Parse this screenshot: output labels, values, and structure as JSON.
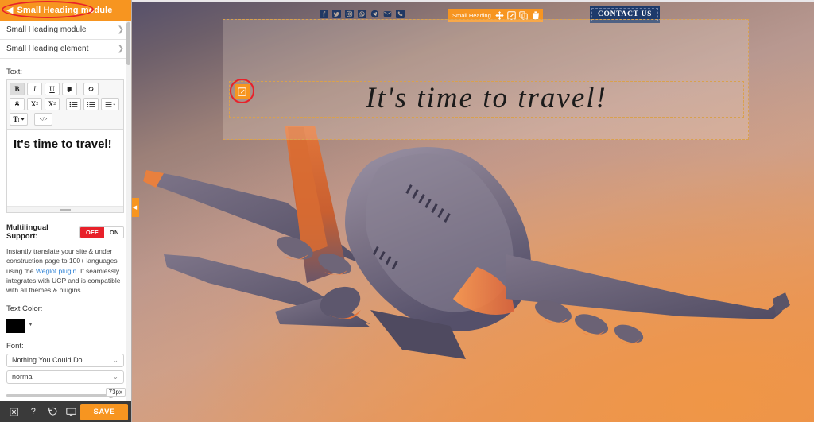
{
  "panel": {
    "header_title": "Small Heading module",
    "back_icon": "arrow-left-icon",
    "accordion": [
      {
        "label": "Small Heading module",
        "chevron": "chevron-right-icon"
      },
      {
        "label": "Small Heading element",
        "chevron": "chevron-down-icon"
      }
    ],
    "text_field_label": "Text:",
    "editor_toolbar": [
      {
        "name": "bold-icon",
        "glyph": "B",
        "active": true
      },
      {
        "name": "italic-icon",
        "glyph": "I",
        "active": false
      },
      {
        "name": "underline-icon",
        "glyph": "U",
        "active": false
      },
      {
        "name": "format-paint-icon",
        "glyph": "▐",
        "active": false
      },
      {
        "name": "link-icon",
        "glyph": "∞",
        "active": false
      },
      {
        "name": "strikethrough-icon",
        "glyph": "S",
        "active": false
      },
      {
        "name": "superscript-icon",
        "glyph": "X",
        "active": false
      },
      {
        "name": "subscript-icon",
        "glyph": "X",
        "active": false
      },
      {
        "name": "unordered-list-icon",
        "glyph": "≡",
        "active": false
      },
      {
        "name": "ordered-list-icon",
        "glyph": "≡",
        "active": false
      },
      {
        "name": "align-icon",
        "glyph": "≡",
        "active": false
      },
      {
        "name": "text-format-icon",
        "glyph": "T",
        "active": false
      },
      {
        "name": "code-view-icon",
        "glyph": "</>",
        "active": false
      }
    ],
    "editor_value": "It's time to travel!",
    "multilingual": {
      "label": "Multilingual Support:",
      "options": [
        "OFF",
        "ON"
      ],
      "selected": "OFF",
      "description_1": "Instantly translate your site & under construction page to 100+ languages using the ",
      "link_text": "Weglot plugin",
      "description_2": ". It seamlessly integrates with UCP and is compatible with all themes & plugins."
    },
    "text_color": {
      "label": "Text Color:",
      "value": "#000000"
    },
    "font": {
      "label": "Font:",
      "family": "Nothing You Could Do",
      "weight": "normal",
      "size": "73px"
    },
    "footer": {
      "icons": [
        {
          "name": "close-icon",
          "glyph": "☒"
        },
        {
          "name": "help-icon",
          "glyph": "?"
        },
        {
          "name": "history-undo-icon",
          "glyph": "↺"
        },
        {
          "name": "preview-monitor-icon",
          "glyph": "▭"
        }
      ],
      "save_label": "SAVE"
    }
  },
  "canvas": {
    "social_icons": [
      "facebook-icon",
      "twitter-icon",
      "instagram-icon",
      "whatsapp-icon",
      "telegram-icon",
      "email-icon",
      "phone-icon"
    ],
    "module_badge": {
      "label": "Small Heading",
      "icons": [
        "move-icon",
        "edit-icon",
        "duplicate-icon",
        "delete-icon"
      ]
    },
    "contact_button": "CONTACT US",
    "heading_text": "It's time to travel!",
    "element_edit_icon": "edit-icon",
    "collapse_tab_icon": "caret-left-icon"
  },
  "colors": {
    "accent_orange": "#f79520",
    "highlight_red": "#e8212a",
    "toggle_off_red": "#e8212a",
    "contact_navy": "#1d3a6b",
    "social_navy": "#1f3864",
    "footer_dark": "#3a3a3a",
    "dashed_outline": "#d9a14e",
    "link_blue": "#2a7fd4"
  }
}
